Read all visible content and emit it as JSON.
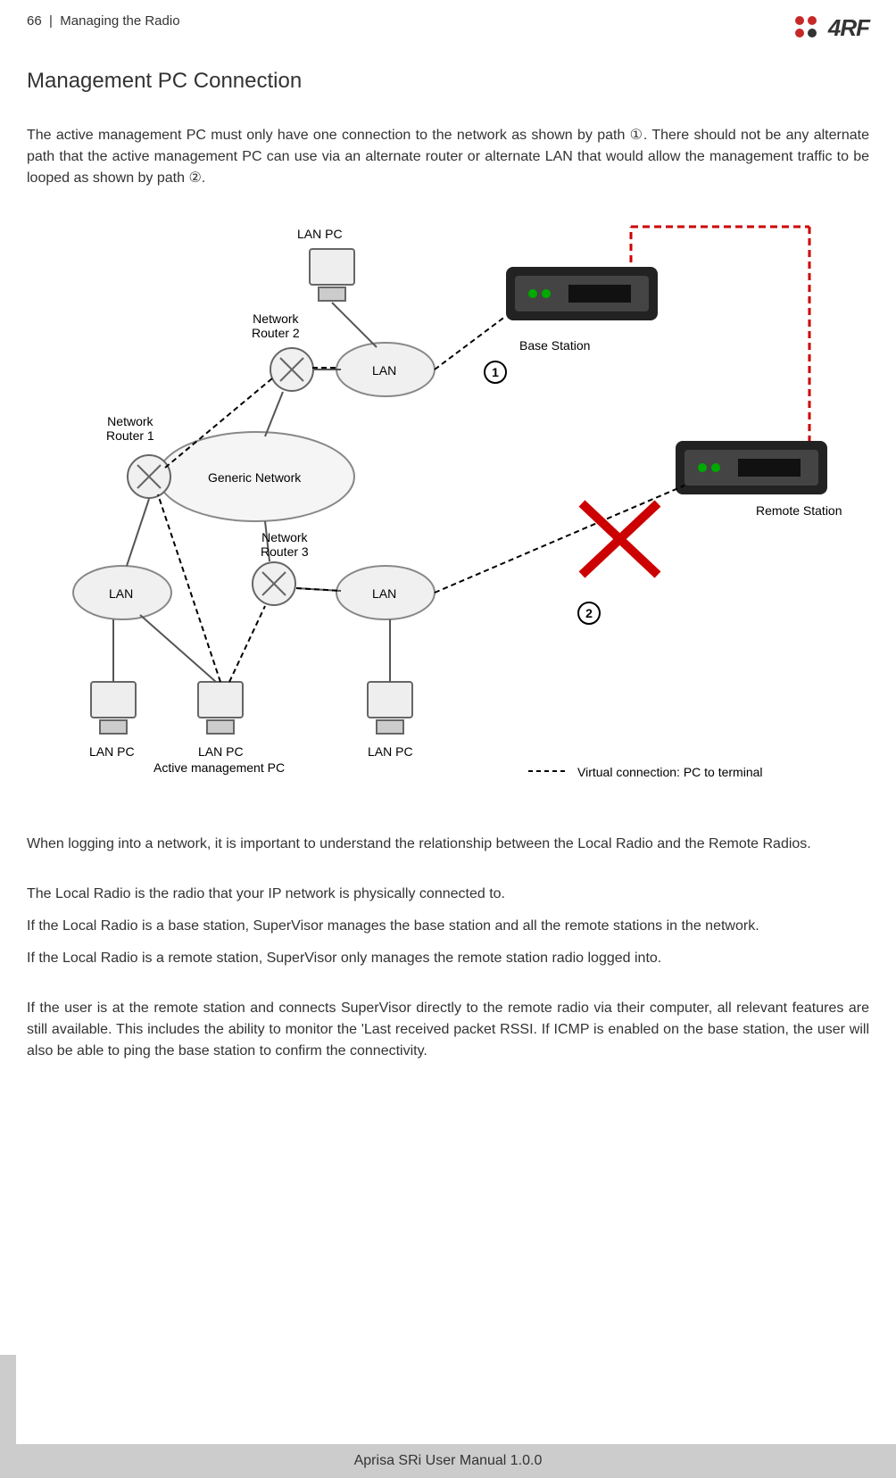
{
  "header": {
    "page_number": "66",
    "separator": "|",
    "section_name": "Managing the Radio",
    "logo_text": "4RF"
  },
  "content": {
    "title": "Management PC Connection",
    "paragraph_1": "The active management PC must only have one connection to the network as shown by path ①. There should not be any alternate path that the active management PC can use via an alternate router or alternate LAN that would allow the management traffic to be looped as shown by path ②.",
    "paragraph_2": "When logging into a network, it is important to understand the relationship between the Local Radio and the Remote Radios.",
    "paragraph_3": "The Local Radio is the radio that your IP network is physically connected to.",
    "paragraph_4": "If the Local Radio is a base station, SuperVisor manages the base station and all the remote stations in the network.",
    "paragraph_5": "If the Local Radio is a remote station, SuperVisor only manages the remote station radio logged into.",
    "paragraph_6": "If the user is at the remote station and connects SuperVisor directly to the remote radio via their computer, all relevant features are still available. This includes the ability to monitor the 'Last received packet RSSI. If ICMP is enabled on the base station, the user will also be able to ping the base station to confirm the connectivity."
  },
  "diagram": {
    "labels": {
      "lan_pc_top": "LAN PC",
      "network_router_1": "Network\nRouter 1",
      "network_router_2": "Network\nRouter 2",
      "network_router_3": "Network\nRouter 3",
      "generic_network": "Generic Network",
      "lan_1": "LAN",
      "lan_2": "LAN",
      "lan_3": "LAN",
      "base_station": "Base Station",
      "remote_station": "Remote Station",
      "lan_pc_bottom_1": "LAN PC",
      "lan_pc_bottom_2": "LAN PC",
      "lan_pc_bottom_3": "LAN PC",
      "active_mgmt": "Active management PC",
      "virtual_conn": "Virtual connection: PC to terminal",
      "badge_1": "1",
      "badge_2": "2",
      "virtual_dots": "------"
    }
  },
  "footer": {
    "text": "Aprisa SRi User Manual 1.0.0"
  }
}
